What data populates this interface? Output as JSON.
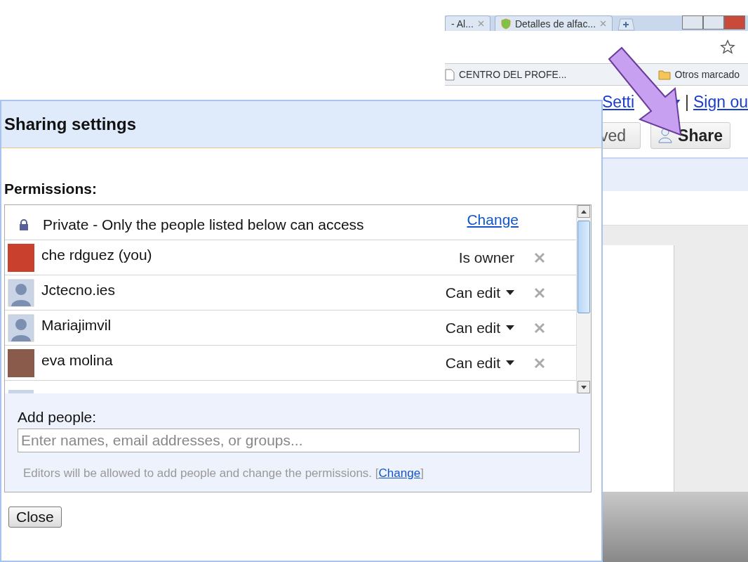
{
  "browser": {
    "tabs": [
      {
        "title": "- Al...",
        "kind": "plain"
      },
      {
        "title": "Detalles de alfac...",
        "kind": "site"
      }
    ],
    "bookmarks": [
      {
        "title": "CENTRO DEL PROFE...",
        "kind": "page"
      },
      {
        "title": "Otros marcado",
        "kind": "folder"
      }
    ],
    "links": [
      "Setti",
      "Sign ou"
    ],
    "separator": "|",
    "toolbar": {
      "saved_label": "ved",
      "share_label": "Share"
    }
  },
  "dialog": {
    "title": "Sharing settings",
    "permissions_label": "Permissions:",
    "visibility": {
      "text": "Private - Only the people listed below can access",
      "change_link": "Change"
    },
    "people": [
      {
        "name": "che rdguez (you)",
        "role": "Is owner",
        "kind": "owner",
        "has_photo": true
      },
      {
        "name": "Jctecno.ies",
        "role": "Can edit",
        "kind": "editor",
        "has_photo": false
      },
      {
        "name": "Mariajimvil",
        "role": "Can edit",
        "kind": "editor",
        "has_photo": false
      },
      {
        "name": "eva molina",
        "role": "Can edit",
        "kind": "editor",
        "has_photo": true
      }
    ],
    "add_people": {
      "label": "Add people:",
      "placeholder": "Enter names, email addresses, or groups...",
      "note": "Editors will be allowed to add people and change the permissions.",
      "link_open": "[",
      "change_link": "Change",
      "link_close": "]"
    },
    "close_button": "Close"
  }
}
